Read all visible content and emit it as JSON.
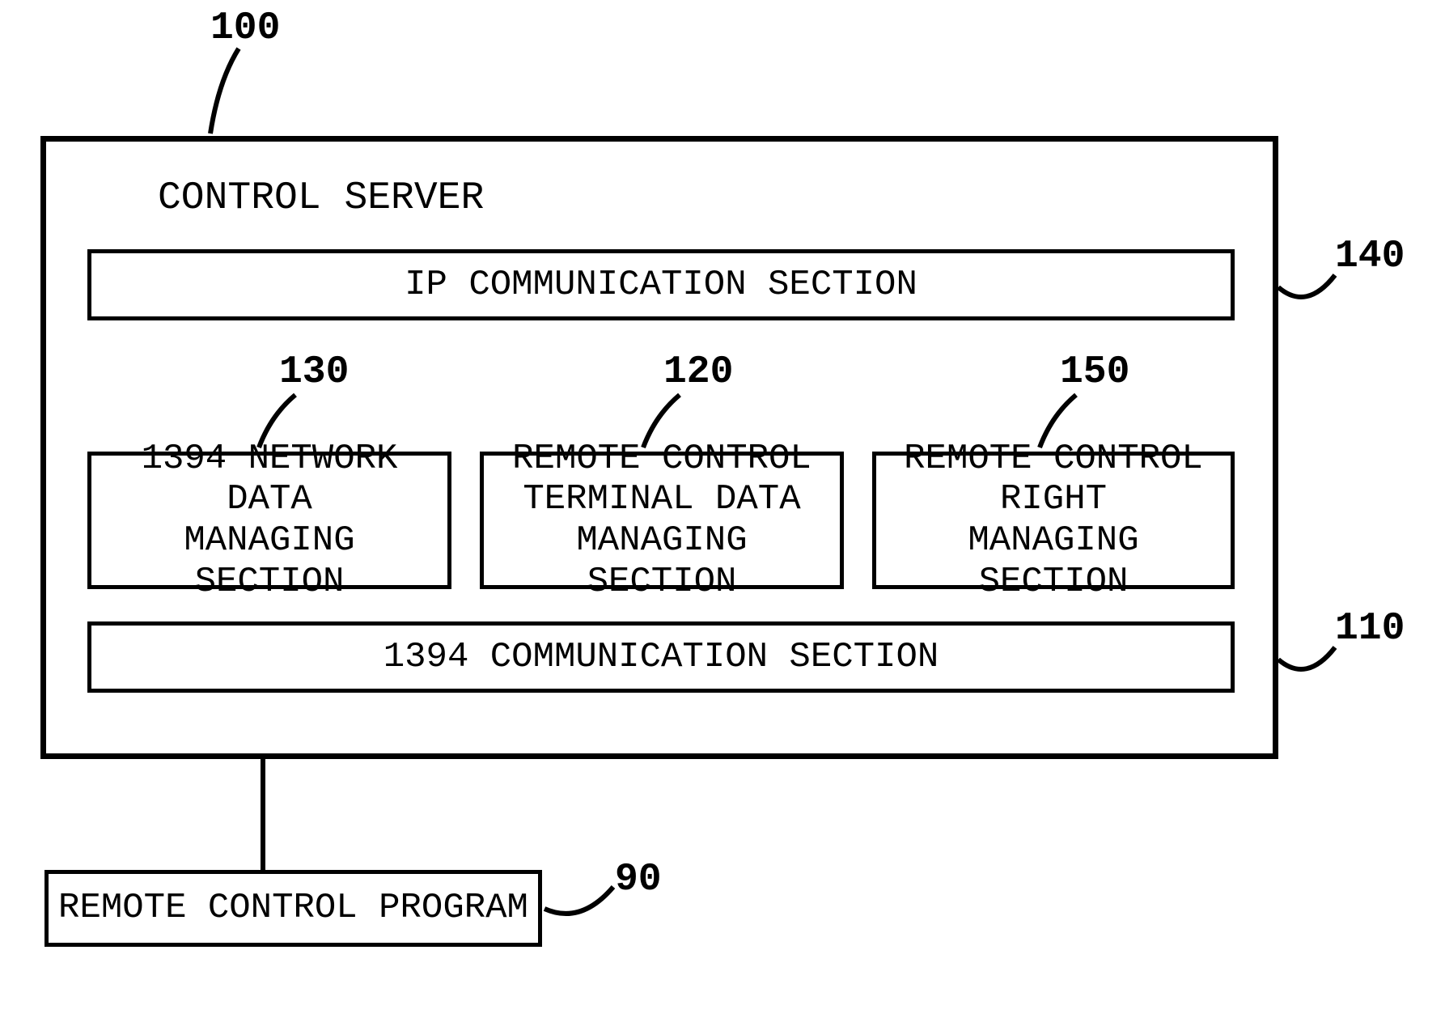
{
  "refs": {
    "r100": "100",
    "r140": "140",
    "r130": "130",
    "r120": "120",
    "r150": "150",
    "r110": "110",
    "r90": "90"
  },
  "server": {
    "title": "CONTROL SERVER",
    "ip_comm": "IP COMMUNICATION SECTION",
    "net_data": "1394 NETWORK DATA\nMANAGING SECTION",
    "term_data": "REMOTE CONTROL\nTERMINAL DATA\nMANAGING SECTION",
    "right_mgr": "REMOTE CONTROL\nRIGHT\nMANAGING SECTION",
    "comm_1394": "1394 COMMUNICATION SECTION"
  },
  "program": {
    "label": "REMOTE CONTROL PROGRAM"
  }
}
